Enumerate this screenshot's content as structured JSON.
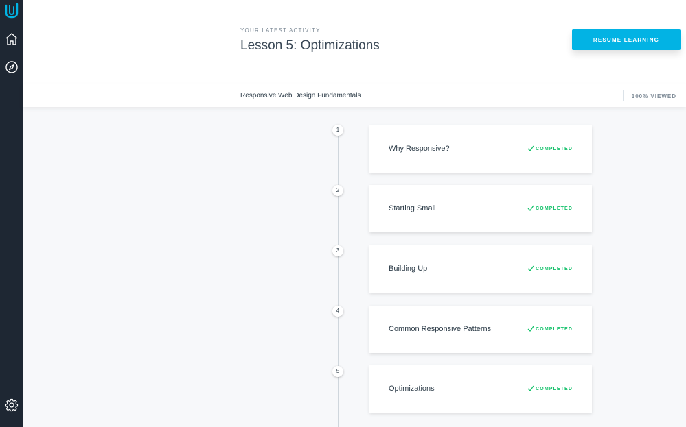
{
  "sidebar": {
    "icons": [
      "udacity-logo-icon",
      "home-icon",
      "compass-icon",
      "gear-icon"
    ],
    "colors": {
      "background": "#1e2733",
      "logo": "#02b3e4",
      "icon": "#ffffff"
    }
  },
  "header": {
    "eyebrow": "YOUR LATEST ACTIVITY",
    "title": "Lesson 5: Optimizations",
    "resume_label": "RESUME LEARNING"
  },
  "course": {
    "name": "Responsive Web Design Fundamentals",
    "viewed": "100% VIEWED"
  },
  "lessons": [
    {
      "number": "1",
      "title": "Why Responsive?",
      "status": "COMPLETED"
    },
    {
      "number": "2",
      "title": "Starting Small",
      "status": "COMPLETED"
    },
    {
      "number": "3",
      "title": "Building Up",
      "status": "COMPLETED"
    },
    {
      "number": "4",
      "title": "Common Responsive Patterns",
      "status": "COMPLETED"
    },
    {
      "number": "5",
      "title": "Optimizations",
      "status": "COMPLETED"
    }
  ],
  "colors": {
    "accent": "#02b3e4",
    "completed": "#15c26b"
  }
}
